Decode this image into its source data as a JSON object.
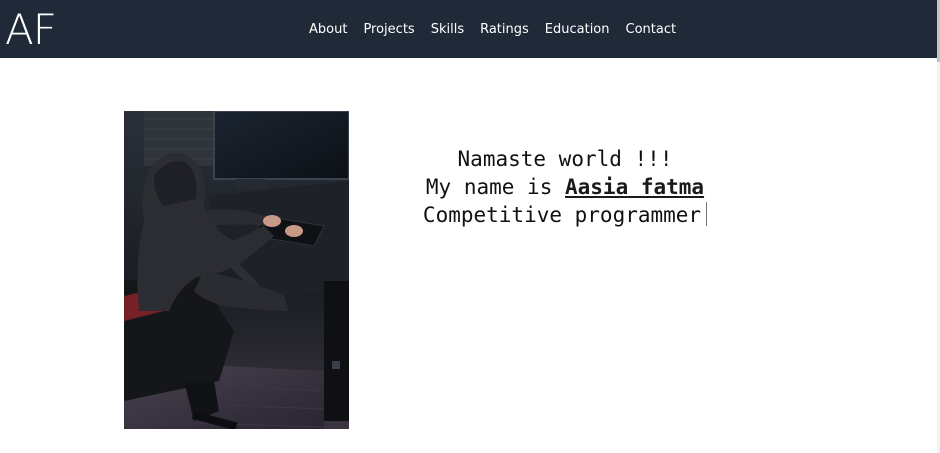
{
  "navbar": {
    "logo": "AF",
    "links": [
      "About",
      "Projects",
      "Skills",
      "Ratings",
      "Education",
      "Contact"
    ]
  },
  "hero": {
    "greeting": "Namaste world !!!",
    "name_prefix": "My name is",
    "name": "Aasia fatma",
    "role": "Competitive programmer",
    "image": "hooded person typing on a keyboard at a computer desk"
  },
  "colors": {
    "navbar_bg": "#1f2937",
    "nav_text": "#ffffff",
    "page_bg": "#ffffff",
    "body_text": "#111111"
  }
}
